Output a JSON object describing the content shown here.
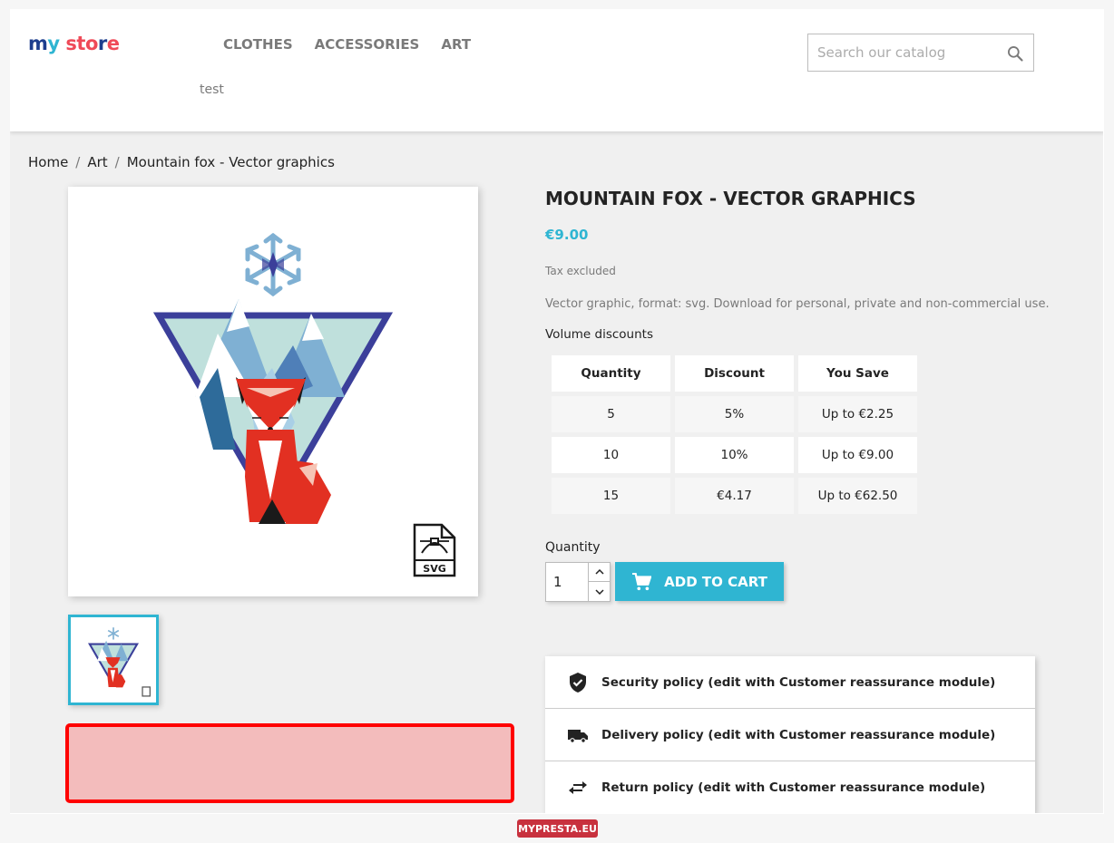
{
  "header": {
    "logo": {
      "text": "my store",
      "letters": [
        {
          "ch": "m",
          "color": "#1d3e8e"
        },
        {
          "ch": "y",
          "color": "#2fb5d2"
        },
        {
          "ch": " ",
          "color": "#000"
        },
        {
          "ch": "s",
          "color": "#ef4a58"
        },
        {
          "ch": "t",
          "color": "#ef4a58"
        },
        {
          "ch": "o",
          "color": "#ef4a58"
        },
        {
          "ch": "r",
          "color": "#1d3e8e"
        },
        {
          "ch": "e",
          "color": "#ef4a58"
        }
      ]
    },
    "nav": [
      {
        "label": "CLOTHES"
      },
      {
        "label": "ACCESSORIES"
      },
      {
        "label": "ART"
      }
    ],
    "subnav_label": "test",
    "search": {
      "placeholder": "Search our catalog",
      "value": "",
      "icon": "search-icon"
    }
  },
  "breadcrumb": [
    {
      "label": "Home"
    },
    {
      "label": "Art"
    },
    {
      "label": "Mountain fox - Vector graphics"
    }
  ],
  "breadcrumb_separator": "/",
  "product": {
    "title": "MOUNTAIN FOX - VECTOR GRAPHICS",
    "price": "€9.00",
    "tax_note": "Tax excluded",
    "description": "Vector graphic, format: svg. Download for personal, private and non-commercial use.",
    "image_alt": "Mountain fox vector graphic",
    "svg_badge": "SVG",
    "volume_discounts": {
      "label": "Volume discounts",
      "headers": [
        "Quantity",
        "Discount",
        "You Save"
      ],
      "rows": [
        [
          "5",
          "5%",
          "Up to €2.25"
        ],
        [
          "10",
          "10%",
          "Up to €9.00"
        ],
        [
          "15",
          "€4.17",
          "Up to €62.50"
        ]
      ]
    },
    "quantity": {
      "label": "Quantity",
      "value": "1"
    },
    "add_to_cart": "ADD TO CART"
  },
  "reassurance": [
    {
      "icon": "shield-check-icon",
      "label": "Security policy (edit with Customer reassurance module)"
    },
    {
      "icon": "truck-icon",
      "label": "Delivery policy (edit with Customer reassurance module)"
    },
    {
      "icon": "swap-arrows-icon",
      "label": "Return policy (edit with Customer reassurance module)"
    }
  ],
  "colors": {
    "accent": "#2fb5d2",
    "highlight_border": "#ff0000",
    "highlight_fill": "#f3bcbc",
    "badge": "#c8313e"
  },
  "footer_badge": "MYPRESTA.EU"
}
